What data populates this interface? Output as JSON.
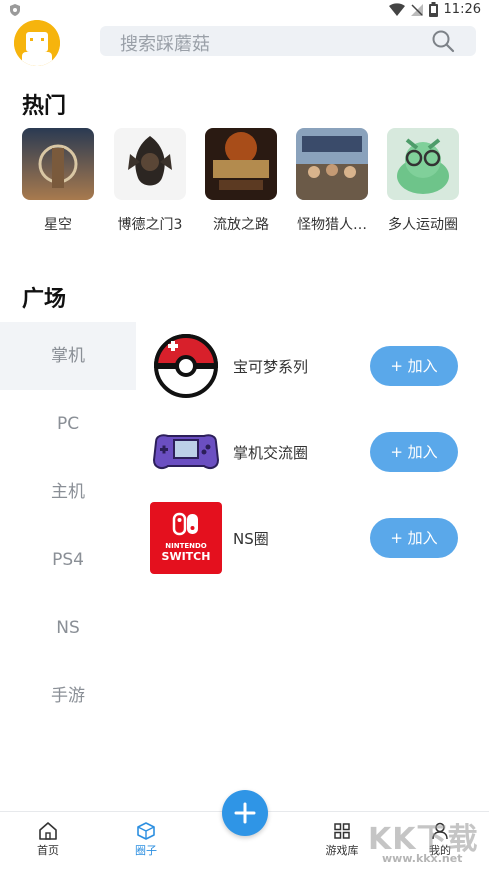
{
  "status_bar": {
    "time": "11:26"
  },
  "search": {
    "placeholder": "搜索踩蘑菇"
  },
  "hot": {
    "title": "热门",
    "items": [
      {
        "label": "星空"
      },
      {
        "label": "博德之门3"
      },
      {
        "label": "流放之路"
      },
      {
        "label": "怪物猎人…"
      },
      {
        "label": "多人运动圈"
      }
    ]
  },
  "plaza": {
    "title": "广场",
    "categories": [
      {
        "label": "掌机"
      },
      {
        "label": "PC"
      },
      {
        "label": "主机"
      },
      {
        "label": "PS4"
      },
      {
        "label": "NS"
      },
      {
        "label": "手游"
      }
    ],
    "active_category": "掌机",
    "circles": [
      {
        "name": "宝可梦系列",
        "button": "+ 加入"
      },
      {
        "name": "掌机交流圈",
        "button": "+ 加入"
      },
      {
        "name": "NS圈",
        "button": "+ 加入",
        "logo_text": "NINTENDO SWITCH"
      }
    ]
  },
  "bottom_nav": {
    "items": [
      {
        "label": "首页"
      },
      {
        "label": "圈子"
      },
      {
        "label": "游戏库"
      },
      {
        "label": "我的"
      }
    ],
    "active": "圈子"
  },
  "watermark": {
    "big": "KK下载",
    "small": "www.kkx.net"
  },
  "colors": {
    "accent": "#2f95e6",
    "join_button": "#5aa8ea",
    "avatar_bg": "#f6b40d",
    "search_bg": "#eef1f5",
    "active_category_bg": "#f2f4f7"
  }
}
